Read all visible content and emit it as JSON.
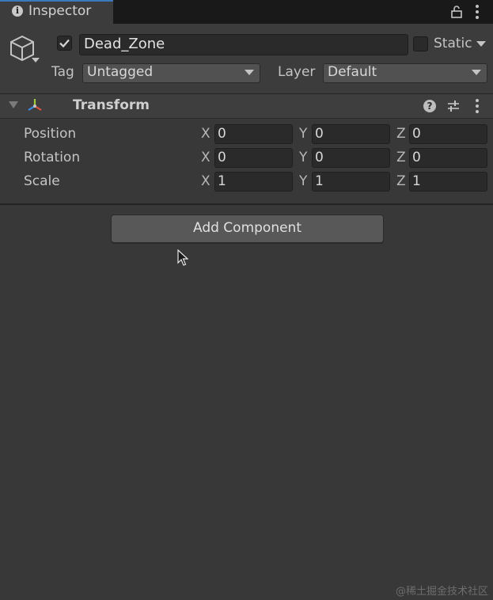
{
  "tab": {
    "title": "Inspector"
  },
  "object": {
    "name": "Dead_Zone",
    "active": true,
    "static_label": "Static",
    "static_checked": false,
    "tag_label": "Tag",
    "tag_value": "Untagged",
    "layer_label": "Layer",
    "layer_value": "Default"
  },
  "transform": {
    "title": "Transform",
    "axis_labels": [
      "X",
      "Y",
      "Z"
    ],
    "rows": [
      {
        "label": "Position",
        "values": [
          "0",
          "0",
          "0"
        ]
      },
      {
        "label": "Rotation",
        "values": [
          "0",
          "0",
          "0"
        ]
      },
      {
        "label": "Scale",
        "values": [
          "1",
          "1",
          "1"
        ]
      }
    ]
  },
  "add_component_label": "Add Component",
  "watermark": "@稀土掘金技术社区",
  "icons": {
    "tab": "info-icon",
    "lock": "lock-icon",
    "menu": "kebab-menu-icon",
    "object": "cube-icon",
    "component": "transform-axes-icon",
    "help": "help-icon",
    "presets": "sliders-icon",
    "cursor": "mouse-pointer-icon"
  },
  "colors": {
    "background": "#383838",
    "tab_accent": "#3a79bb",
    "field": "#2a2a2a",
    "button": "#585858"
  }
}
